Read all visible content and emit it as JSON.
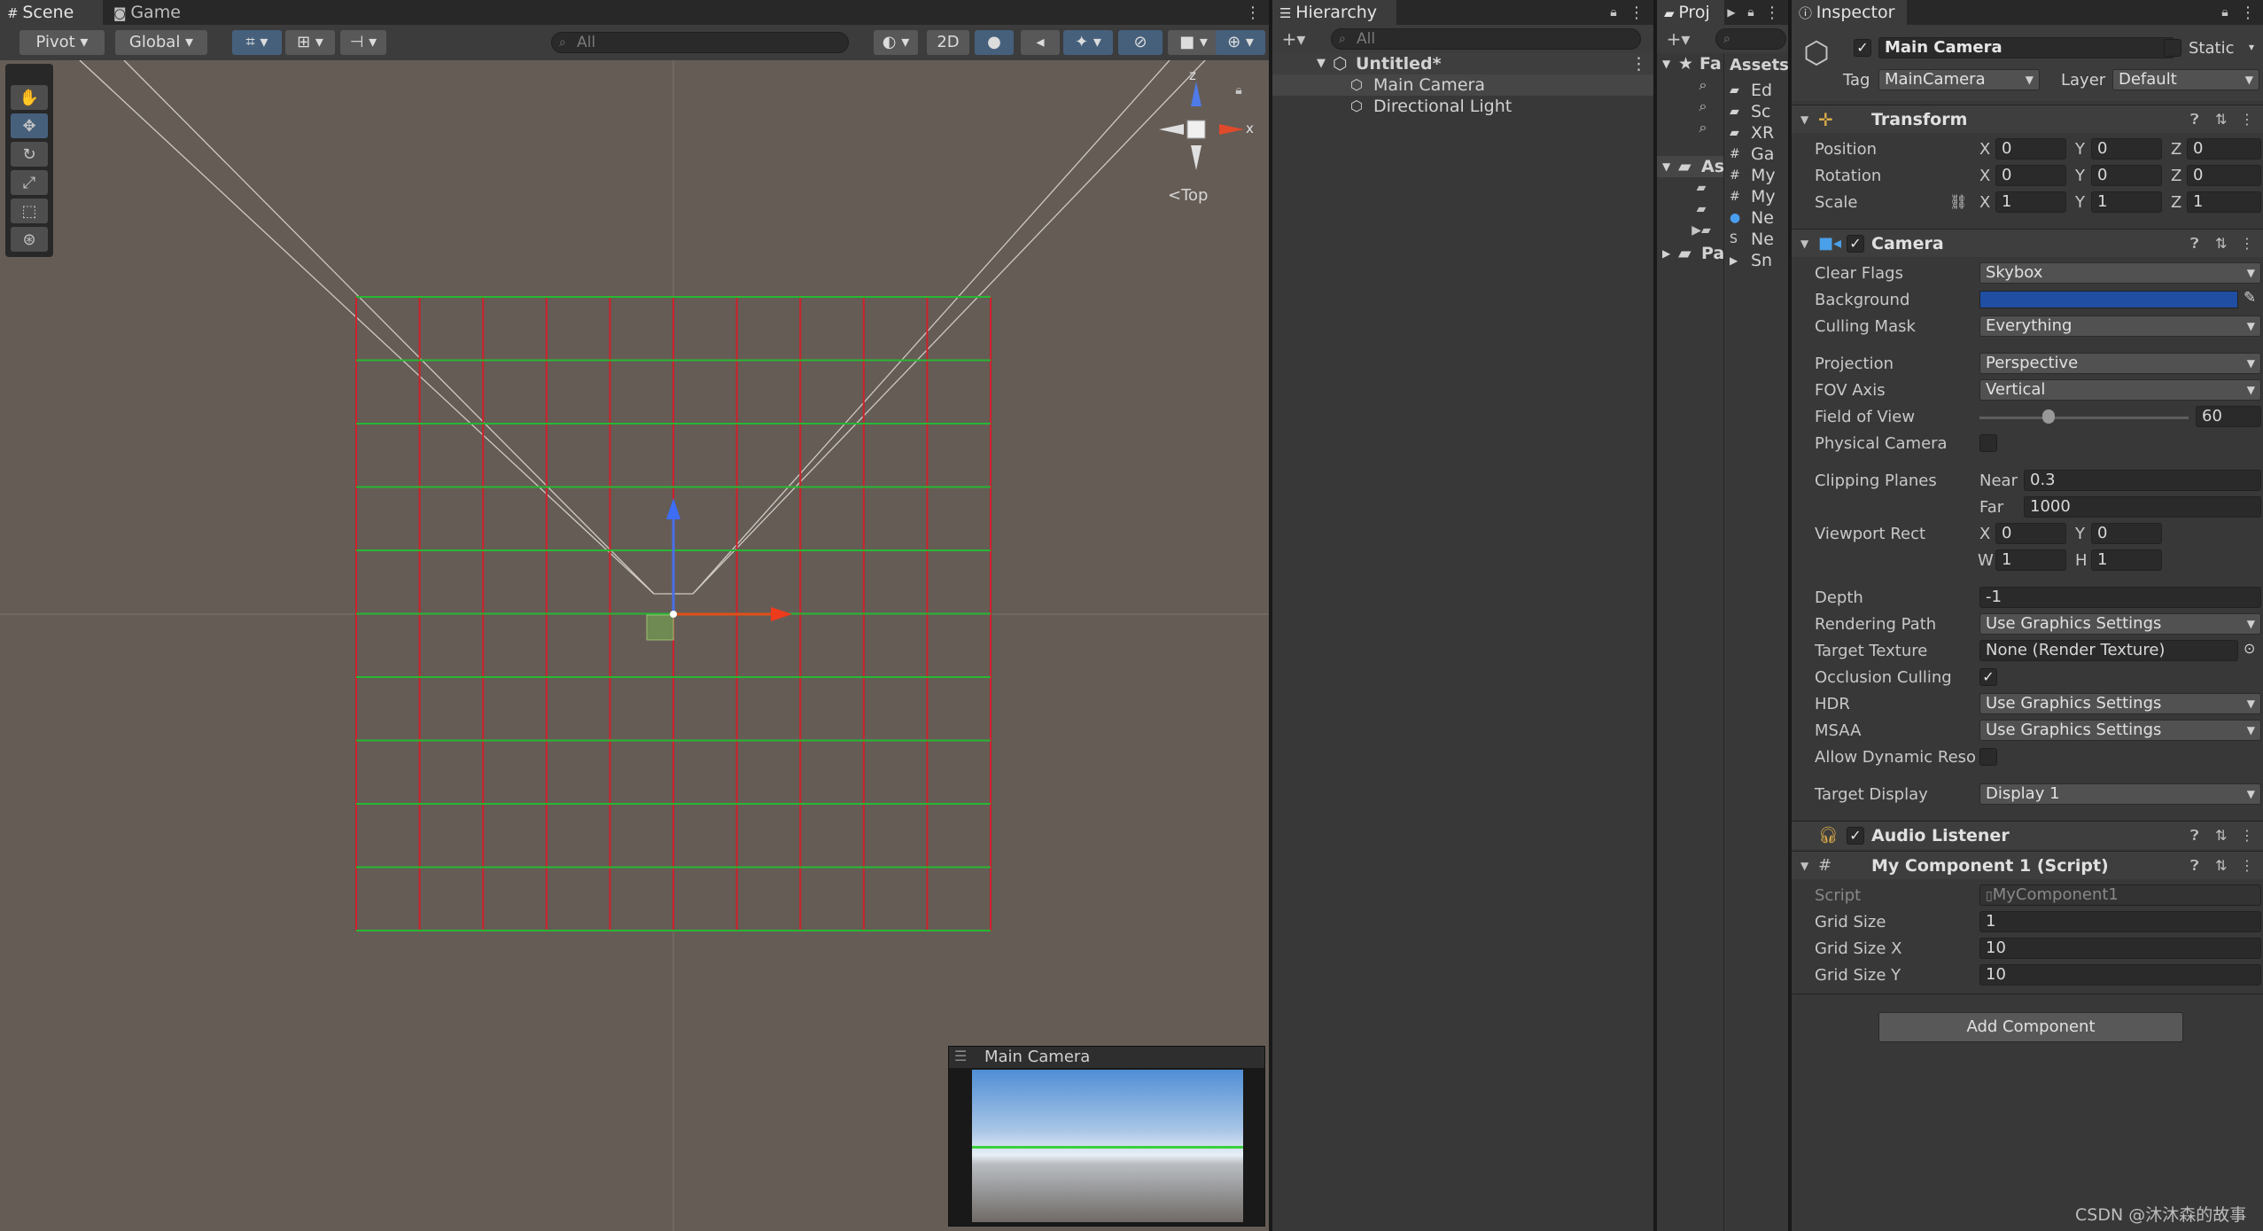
{
  "scene_tabs": {
    "scene": "Scene",
    "game": "Game"
  },
  "scene_toolbar": {
    "pivot": "Pivot",
    "global": "Global",
    "search_placeholder": "All",
    "mode_2d": "2D"
  },
  "gizmo": {
    "view_label": "Top",
    "axis_z": "z",
    "axis_x": "x"
  },
  "camera_preview": {
    "title": "Main Camera"
  },
  "hierarchy": {
    "tab": "Hierarchy",
    "search_placeholder": "All",
    "scene_name": "Untitled*",
    "items": [
      "Main Camera",
      "Directional Light"
    ]
  },
  "project": {
    "tab": "Proj",
    "favorites": "Fa",
    "assets_root": "As",
    "packages": "Pa",
    "assets_header": "Assets",
    "asset_items": [
      "Ed",
      "Sc",
      "XR",
      "Ga",
      "My",
      "My",
      "Ne",
      "Ne",
      "Sn"
    ]
  },
  "inspector": {
    "tab": "Inspector",
    "object_name": "Main Camera",
    "static_label": "Static",
    "tag_label": "Tag",
    "tag_value": "MainCamera",
    "layer_label": "Layer",
    "layer_value": "Default",
    "transform": {
      "title": "Transform",
      "position_label": "Position",
      "rotation_label": "Rotation",
      "scale_label": "Scale",
      "position": {
        "x": "0",
        "y": "0",
        "z": "0"
      },
      "rotation": {
        "x": "0",
        "y": "0",
        "z": "0"
      },
      "scale": {
        "x": "1",
        "y": "1",
        "z": "1"
      }
    },
    "camera": {
      "title": "Camera",
      "clear_flags_label": "Clear Flags",
      "clear_flags": "Skybox",
      "background_label": "Background",
      "background_color": "#1f4ea3",
      "culling_mask_label": "Culling Mask",
      "culling_mask": "Everything",
      "projection_label": "Projection",
      "projection": "Perspective",
      "fov_axis_label": "FOV Axis",
      "fov_axis": "Vertical",
      "fov_label": "Field of View",
      "fov": "60",
      "fov_slider_fraction": 0.33,
      "physical_label": "Physical Camera",
      "clipping_label": "Clipping Planes",
      "near_label": "Near",
      "near": "0.3",
      "far_label": "Far",
      "far": "1000",
      "viewport_label": "Viewport Rect",
      "vx": "0",
      "vy": "0",
      "vw": "1",
      "vh": "1",
      "depth_label": "Depth",
      "depth": "-1",
      "rendering_path_label": "Rendering Path",
      "rendering_path": "Use Graphics Settings",
      "target_texture_label": "Target Texture",
      "target_texture": "None (Render Texture)",
      "occlusion_label": "Occlusion Culling",
      "hdr_label": "HDR",
      "hdr": "Use Graphics Settings",
      "msaa_label": "MSAA",
      "msaa": "Use Graphics Settings",
      "dynamic_res_label": "Allow Dynamic Reso",
      "target_display_label": "Target Display",
      "target_display": "Display 1"
    },
    "audio_listener": {
      "title": "Audio Listener"
    },
    "my_component": {
      "title": "My Component 1 (Script)",
      "script_label": "Script",
      "script": "MyComponent1",
      "grid_size_label": "Grid Size",
      "grid_size": "1",
      "grid_size_x_label": "Grid Size X",
      "grid_size_x": "10",
      "grid_size_y_label": "Grid Size Y",
      "grid_size_y": "10"
    },
    "add_component": "Add Component"
  },
  "axis_letters": {
    "x": "X",
    "y": "Y",
    "z": "Z",
    "w": "W",
    "h": "H"
  },
  "watermark": "CSDN @沐沐森的故事",
  "colors": {
    "scene_bg": "#655c56",
    "grid_red": "#d0202a",
    "grid_green": "#27b832",
    "accent_blue": "#46607c"
  }
}
